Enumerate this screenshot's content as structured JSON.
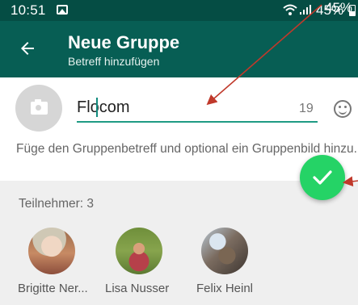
{
  "status_bar": {
    "time": "10:51",
    "battery_text": "45%",
    "icons": [
      "gallery-icon",
      "wifi-icon",
      "signal-icon",
      "battery-icon"
    ]
  },
  "app_bar": {
    "back_icon": "arrow-left-icon",
    "title": "Neue Gruppe",
    "subtitle": "Betreff hinzufügen"
  },
  "subject": {
    "value": "Flocom",
    "char_count": "19",
    "photo_icon": "camera-icon",
    "emoji_icon": "emoji-icon"
  },
  "hint": "Füge den Gruppenbetreff und optional ein Gruppenbild hinzu.",
  "participants": {
    "count_label": "Teilnehmer: 3",
    "members": [
      {
        "name": "Brigitte Ner..."
      },
      {
        "name": "Lisa Nusser"
      },
      {
        "name": "Felix Heinl"
      }
    ]
  },
  "fab": {
    "icon": "checkmark-icon"
  },
  "annotation": {
    "label": "45%",
    "arrow_color": "#c0392b"
  },
  "colors": {
    "status_bar": "#054d44",
    "app_bar": "#075e54",
    "accent": "#1f9b84",
    "fab": "#25d366"
  }
}
